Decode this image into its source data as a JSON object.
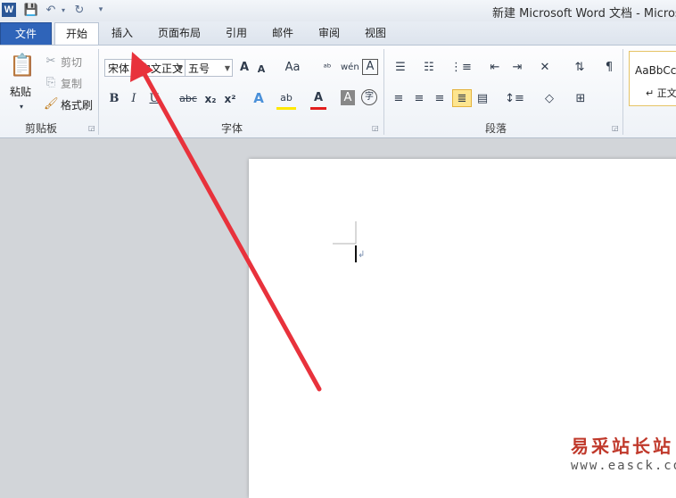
{
  "title_bar": {
    "app_icon": "W",
    "title": "新建 Microsoft Word 文档 - Micros"
  },
  "tabs": [
    {
      "label": "文件"
    },
    {
      "label": "开始"
    },
    {
      "label": "插入"
    },
    {
      "label": "页面布局"
    },
    {
      "label": "引用"
    },
    {
      "label": "邮件"
    },
    {
      "label": "审阅"
    },
    {
      "label": "视图"
    }
  ],
  "clipboard": {
    "paste": "粘贴",
    "cut": "剪切",
    "copy": "复制",
    "format_painter": "格式刷",
    "group_label": "剪贴板"
  },
  "font": {
    "font_name": "宋体（中文正文",
    "font_size": "五号",
    "group_label": "字体",
    "bold": "B",
    "italic": "I",
    "underline": "U",
    "strike": "abc",
    "subscript": "x₂",
    "superscript": "x²",
    "grow": "A",
    "shrink": "A",
    "case": "Aa",
    "text_effects": "A",
    "highlight": "ab",
    "font_color": "A",
    "shading": "A",
    "enclose": "字"
  },
  "paragraph": {
    "group_label": "段落"
  },
  "styles": {
    "preview": "AaBbCcD",
    "normal": "↵ 正文"
  },
  "watermark": {
    "line1": "易采站长站",
    "line2": "www.easck.com"
  },
  "colors": {
    "file_tab": "#2f64b9",
    "arrow": "#e8323c"
  }
}
